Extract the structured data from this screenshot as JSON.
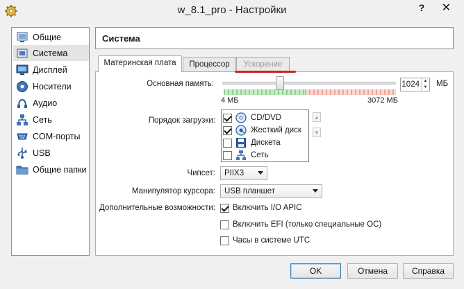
{
  "window": {
    "title": "w_8.1_pro - Настройки",
    "help_label": "?",
    "close_label": "✕"
  },
  "sidebar": {
    "items": [
      {
        "label": "Общие",
        "icon": "general-icon"
      },
      {
        "label": "Система",
        "icon": "system-icon",
        "selected": true
      },
      {
        "label": "Дисплей",
        "icon": "display-icon"
      },
      {
        "label": "Носители",
        "icon": "storage-icon"
      },
      {
        "label": "Аудио",
        "icon": "audio-icon"
      },
      {
        "label": "Сеть",
        "icon": "network-icon"
      },
      {
        "label": "COM-порты",
        "icon": "serial-ports-icon"
      },
      {
        "label": "USB",
        "icon": "usb-icon"
      },
      {
        "label": "Общие папки",
        "icon": "shared-folders-icon"
      }
    ]
  },
  "section": {
    "title": "Система"
  },
  "tabs": [
    {
      "label": "Материнская плата",
      "active": true
    },
    {
      "label": "Процессор"
    },
    {
      "label": "Ускорение",
      "disabled": true
    }
  ],
  "motherboard": {
    "memory_label": "Основная память:",
    "memory_value": "1024",
    "memory_unit": "МБ",
    "memory_min_label": "4 МБ",
    "memory_max_label": "3072 МБ",
    "memory_slider_fraction": 0.33,
    "boot_order_label": "Порядок загрузки:",
    "boot_devices": [
      {
        "label": "CD/DVD",
        "checked": true,
        "icon": "cd-dvd-icon"
      },
      {
        "label": "Жесткий диск",
        "checked": true,
        "icon": "hard-disk-icon"
      },
      {
        "label": "Дискета",
        "checked": false,
        "icon": "floppy-icon"
      },
      {
        "label": "Сеть",
        "checked": false,
        "icon": "network-boot-icon"
      }
    ],
    "chipset_label": "Чипсет:",
    "chipset_value": "PIIX3",
    "pointing_label": "Манипулятор курсора:",
    "pointing_value": "USB планшет",
    "extended_label": "Дополнительные возможности:",
    "features": [
      {
        "label": "Включить I/O APIC",
        "checked": true
      },
      {
        "label": "Включить EFI (только специальные ОС)",
        "checked": false
      },
      {
        "label": "Часы в системе UTC",
        "checked": false
      }
    ]
  },
  "buttons": {
    "ok": "OK",
    "cancel": "Отмена",
    "help": "Справка"
  },
  "colors": {
    "accent_underline": "#cc2121",
    "slider_safe": "#8fd18f",
    "slider_danger": "#f0a59a"
  }
}
